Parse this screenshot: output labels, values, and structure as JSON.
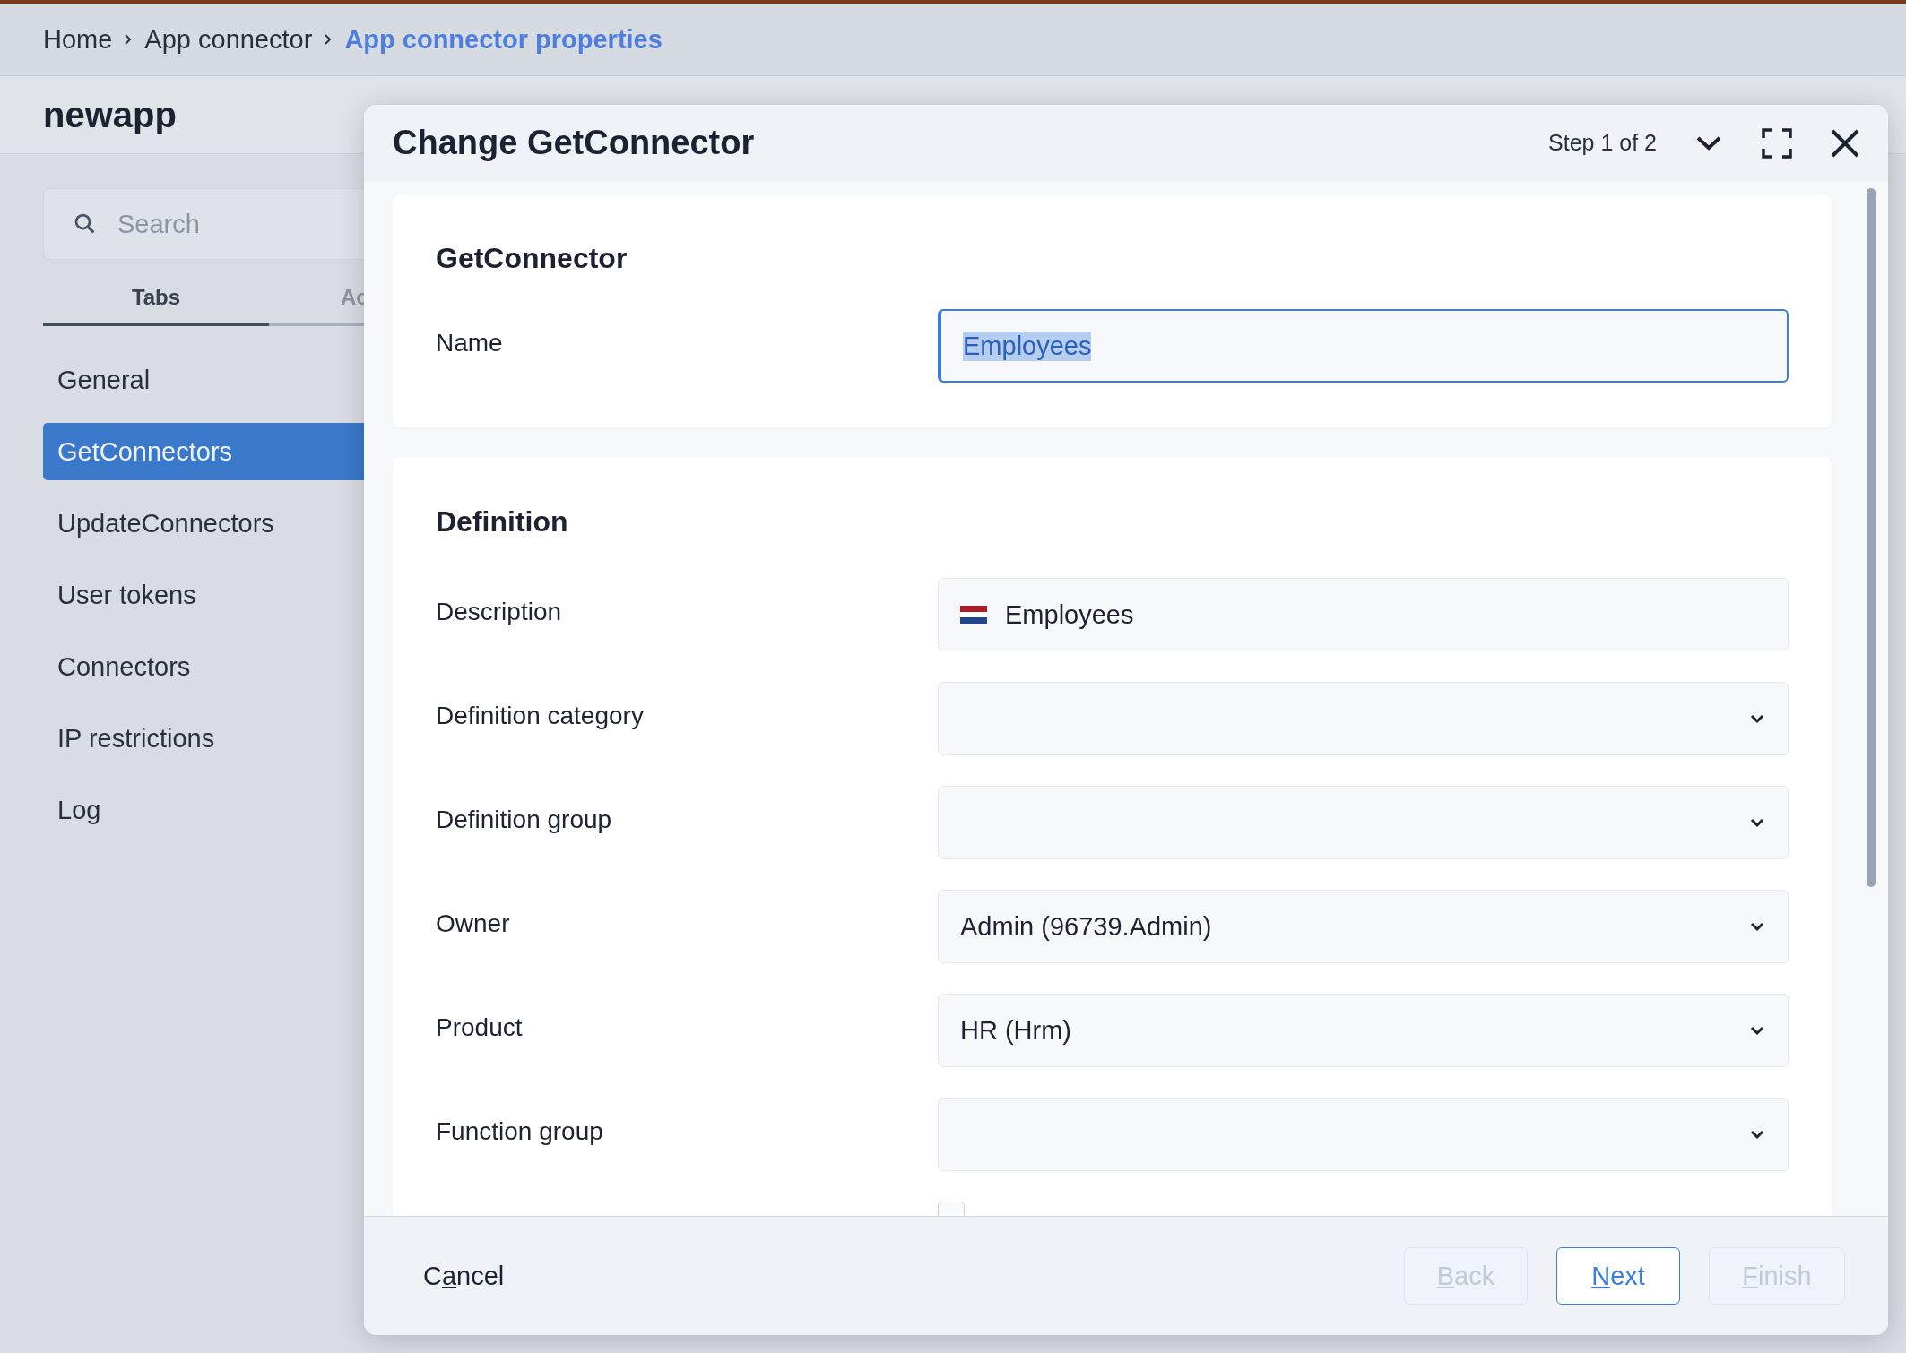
{
  "breadcrumb": [
    {
      "label": "Home",
      "current": false
    },
    {
      "label": "App connector",
      "current": false
    },
    {
      "label": "App connector properties",
      "current": true
    }
  ],
  "page_title": "newapp",
  "sidebar": {
    "search": {
      "placeholder": "Search"
    },
    "tabs": [
      {
        "label": "Tabs",
        "selected": true
      },
      {
        "label": "Ac",
        "selected": false
      }
    ],
    "items": [
      {
        "label": "General",
        "selected": false
      },
      {
        "label": "GetConnectors",
        "selected": true
      },
      {
        "label": "UpdateConnectors",
        "selected": false
      },
      {
        "label": "User tokens",
        "selected": false
      },
      {
        "label": "Connectors",
        "selected": false
      },
      {
        "label": "IP restrictions",
        "selected": false
      },
      {
        "label": "Log",
        "selected": false
      }
    ]
  },
  "dialog": {
    "title": "Change GetConnector",
    "step": "Step 1 of 2",
    "sections": [
      {
        "title": "GetConnector",
        "fields": [
          {
            "label": "Name",
            "kind": "text",
            "value": "Employees",
            "focused": true,
            "text_selected": true
          }
        ]
      },
      {
        "title": "Definition",
        "fields": [
          {
            "label": "Description",
            "kind": "flag-text",
            "value": "Employees"
          },
          {
            "label": "Definition category",
            "kind": "dropdown"
          },
          {
            "label": "Definition group",
            "kind": "dropdown"
          },
          {
            "label": "Owner",
            "kind": "dropdown",
            "value": "Admin (96739.Admin)"
          },
          {
            "label": "Product",
            "kind": "dropdown",
            "value": "HR (Hrm)"
          },
          {
            "label": "Function group",
            "kind": "dropdown"
          },
          {
            "kind": "checkbox",
            "checked": false
          }
        ]
      }
    ],
    "footer": {
      "cancel": {
        "before": "C",
        "key": "a",
        "after": "ncel"
      },
      "buttons": [
        {
          "key": "B",
          "after": "ack",
          "kind": "secondary",
          "disabled": true
        },
        {
          "key": "N",
          "after": "ext",
          "kind": "primary",
          "disabled": false
        },
        {
          "key": "F",
          "after": "inish",
          "kind": "secondary",
          "disabled": true
        }
      ]
    }
  }
}
